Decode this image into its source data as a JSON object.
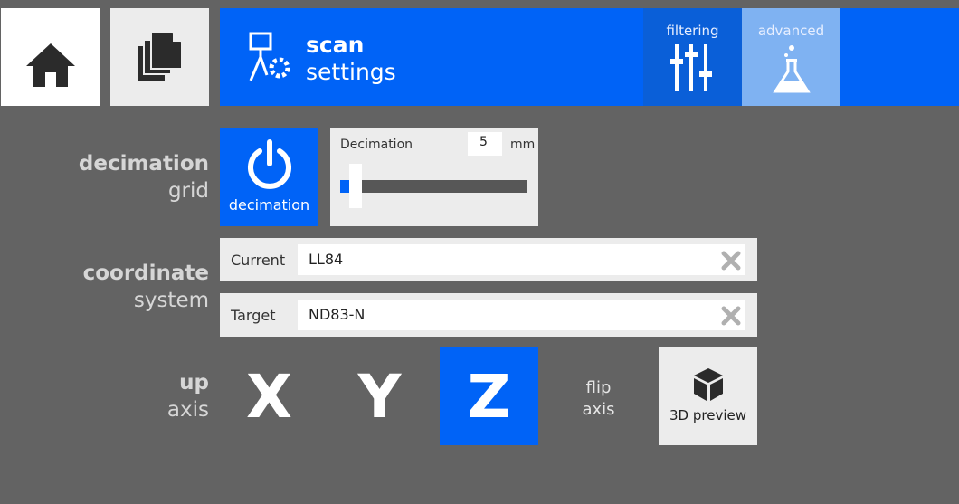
{
  "header": {
    "title_bold": "scan",
    "title_light": "settings",
    "tabs": [
      {
        "label": "filtering",
        "icon": "sliders-icon"
      },
      {
        "label": "advanced",
        "icon": "flask-icon"
      }
    ]
  },
  "nav": {
    "home_icon": "home-icon",
    "pages_icon": "pages-icon"
  },
  "decimation": {
    "section_bold": "decimation",
    "section_light": "grid",
    "toggle_label": "decimation",
    "slider_label": "Decimation",
    "value": "5",
    "unit": "mm"
  },
  "coordinate": {
    "section_bold": "coordinate",
    "section_light": "system",
    "current_label": "Current",
    "current_value": "LL84",
    "target_label": "Target",
    "target_value": "ND83-N"
  },
  "axis": {
    "section_bold": "up",
    "section_light": "axis",
    "x": "X",
    "y": "Y",
    "z": "Z",
    "selected": "Z",
    "flip_line1": "flip",
    "flip_line2": "axis",
    "preview_label": "3D preview"
  },
  "colors": {
    "accent": "#0063f7",
    "accent_light": "#7fb2f2",
    "background": "#636363"
  }
}
